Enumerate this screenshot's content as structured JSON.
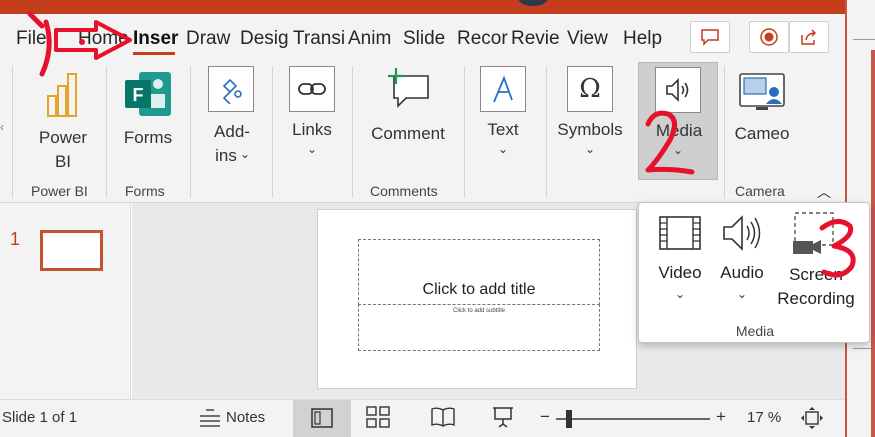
{
  "tabs": [
    {
      "label": "File"
    },
    {
      "label": "Home"
    },
    {
      "label": "Inser"
    },
    {
      "label": "Draw"
    },
    {
      "label": "Desig"
    },
    {
      "label": "Transi"
    },
    {
      "label": "Anim"
    },
    {
      "label": "Slide"
    },
    {
      "label": "Recor"
    },
    {
      "label": "Revie"
    },
    {
      "label": "View"
    },
    {
      "label": "Help"
    }
  ],
  "ribbon": {
    "power_bi": {
      "line1": "Power",
      "line2": "BI"
    },
    "forms": {
      "label": "Forms"
    },
    "addins": {
      "line1": "Add-",
      "line2": "ins"
    },
    "links": {
      "label": "Links"
    },
    "comment": {
      "label": "Comment"
    },
    "text": {
      "label": "Text"
    },
    "symbols": {
      "label": "Symbols"
    },
    "media": {
      "label": "Media"
    },
    "cameo": {
      "label": "Cameo"
    },
    "groups": {
      "power_bi": "Power BI",
      "forms": "Forms",
      "comments": "Comments",
      "camera": "Camera"
    }
  },
  "thumbs": {
    "slide_number": "1"
  },
  "slide": {
    "title_placeholder": "Click to add title",
    "subtitle_placeholder": "Click to add subtitle"
  },
  "media_popup": {
    "video": "Video",
    "audio": "Audio",
    "screen_line1": "Screen",
    "screen_line2": "Recording",
    "group_label": "Media"
  },
  "status": {
    "slide_info": "Slide 1 of 1",
    "notes": "Notes",
    "zoom_minus": "−",
    "zoom_plus": "+",
    "zoom_level": "17 %"
  },
  "annotations": {
    "step1": "1",
    "step2": "2",
    "step3": "3"
  },
  "colors": {
    "accent": "#c43e1c",
    "annotation": "#e8112d",
    "ribbon_bg": "#f3f3f3"
  }
}
